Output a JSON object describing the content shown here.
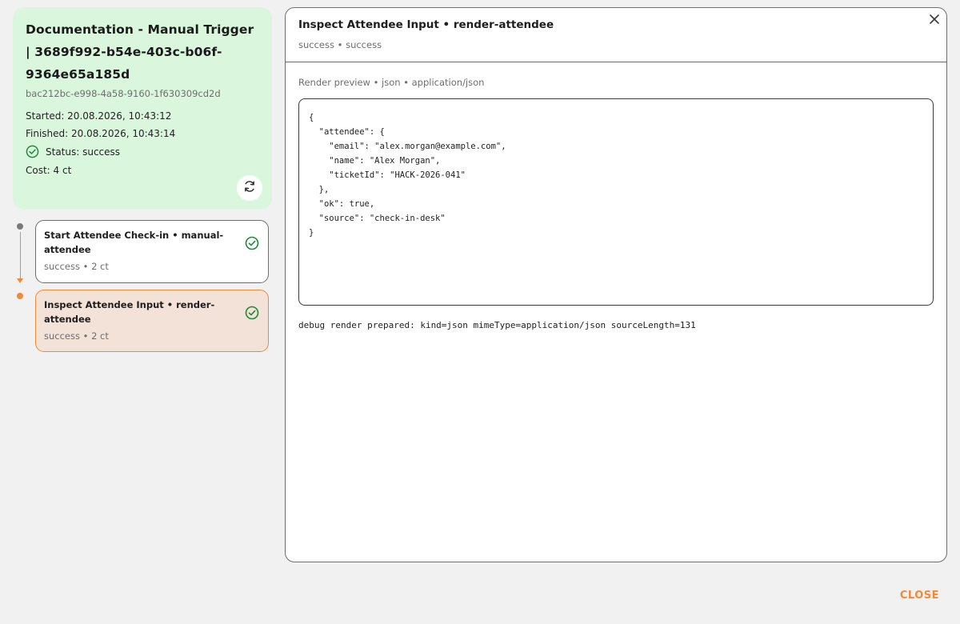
{
  "run": {
    "title": "Documentation - Manual Trigger | 3689f992-b54e-403c-b06f-9364e65a185d",
    "id": "bac212bc-e998-4a58-9160-1f630309cd2d",
    "started": "Started: 20.08.2026, 10:43:12",
    "finished": "Finished: 20.08.2026, 10:43:14",
    "status": "Status: success",
    "cost": "Cost: 4 ct",
    "refresh_icon": "refresh-icon"
  },
  "steps": [
    {
      "title": "Start Attendee Check-in • manual-attendee",
      "sub": "success • 2 ct",
      "icon": "check-circle-icon"
    },
    {
      "title": "Inspect Attendee Input • render-attendee",
      "sub": "success • 2 ct",
      "icon": "check-circle-icon"
    }
  ],
  "detail": {
    "title": "Inspect Attendee Input • render-attendee",
    "subtitle": "success • success",
    "preview_label": "Render preview • json • application/json",
    "code": "{\n  \"attendee\": {\n    \"email\": \"alex.morgan@example.com\",\n    \"name\": \"Alex Morgan\",\n    \"ticketId\": \"HACK-2026-041\"\n  },\n  \"ok\": true,\n  \"source\": \"check-in-desk\"\n}",
    "debug": "debug render prepared: kind=json mimeType=application/json sourceLength=131"
  },
  "footer": {
    "close_label": "CLOSE"
  },
  "colors": {
    "accent": "#f0893a",
    "success": "#1e8a3a",
    "run_card_bg": "#daf7de",
    "active_step_bg": "#f3e2d8"
  }
}
